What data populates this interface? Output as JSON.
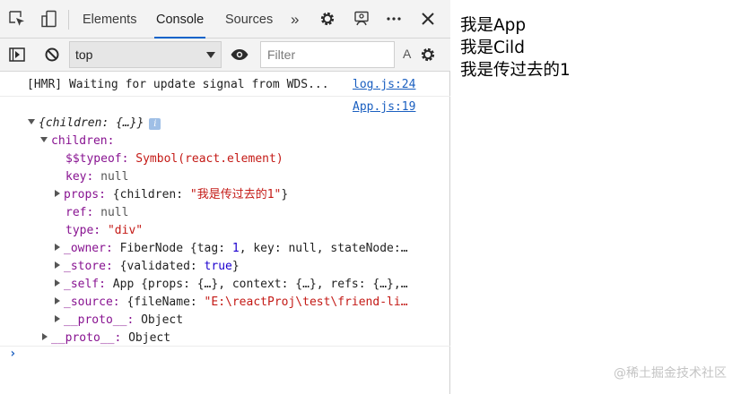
{
  "devtools": {
    "tabs": [
      {
        "label": "Elements"
      },
      {
        "label": "Console"
      },
      {
        "label": "Sources"
      }
    ],
    "more_tabs_label": "»",
    "toolbar": {
      "context": "top",
      "filter_placeholder": "Filter",
      "levels_label": "A"
    },
    "console": {
      "hmr_message": "[HMR] Waiting for update signal from WDS...",
      "hmr_source": "log.js:24",
      "log_source": "App.js:19",
      "object_lines": {
        "root_summary": "{children: {…}}",
        "children_key": "children:",
        "typeof_key": "$$typeof:",
        "typeof_value": "Symbol(react.element)",
        "key_key": "key:",
        "key_value": "null",
        "props_key": "props:",
        "props_value_pre": "{children: ",
        "props_value_str": "\"我是传过去的1\"",
        "props_value_post": "}",
        "ref_key": "ref:",
        "ref_value": "null",
        "type_key": "type:",
        "type_value": "\"div\"",
        "owner_key": "_owner:",
        "owner_value_pre": "FiberNode {tag: ",
        "owner_value_num": "1",
        "owner_value_post": ", key: null, stateNode:…",
        "store_key": "_store:",
        "store_value_pre": "{validated: ",
        "store_value_bool": "true",
        "store_value_post": "}",
        "self_key": "_self:",
        "self_value": "App {props: {…}, context: {…}, refs: {…},…",
        "source_key": "_source:",
        "source_value_pre": "{fileName: ",
        "source_value_str": "\"E:\\reactProj\\test\\friend-li…",
        "proto_key": "__proto__:",
        "proto_value": "Object",
        "proto2_key": "__proto__:",
        "proto2_value": "Object"
      },
      "prompt_symbol": "›"
    }
  },
  "page": {
    "lines": [
      "我是App",
      "我是Cild",
      "我是传过去的1"
    ],
    "watermark": "@稀土掘金技术社区"
  },
  "colors": {
    "link": "#1a5fc0",
    "active_tab_underline": "#0a63c9",
    "object_key": "#881391",
    "string_value": "#c41a16",
    "number_value": "#1c00cf"
  }
}
